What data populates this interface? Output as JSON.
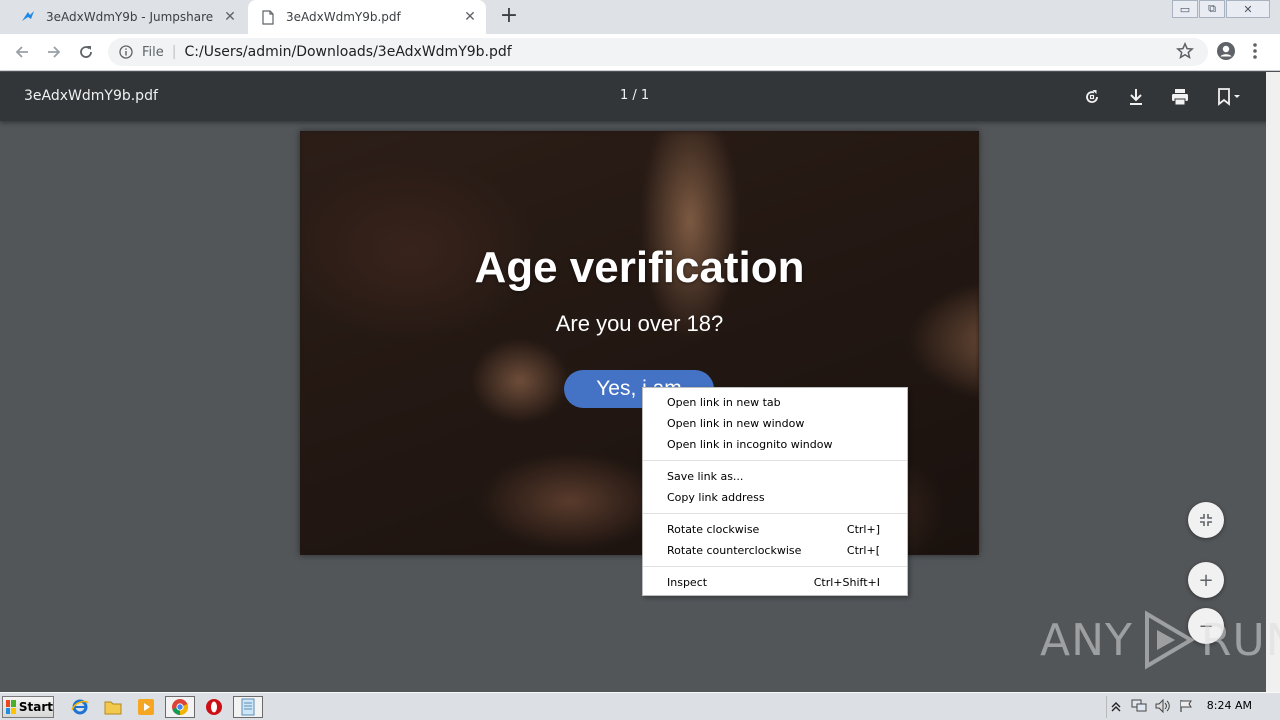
{
  "browser": {
    "tabs": [
      {
        "title": "3eAdxWdmY9b - Jumpshare",
        "favicon": "jumpshare-icon",
        "active": false
      },
      {
        "title": "3eAdxWdmY9b.pdf",
        "favicon": "document-icon",
        "active": true
      }
    ],
    "new_tab_label": "+",
    "window_controls": {
      "minimize": "▭",
      "restore": "⧉",
      "close": "✕"
    },
    "address": {
      "scheme_label": "File",
      "separator": "|",
      "url": "C:/Users/admin/Downloads/3eAdxWdmY9b.pdf"
    }
  },
  "pdf_viewer": {
    "file_name": "3eAdxWdmY9b.pdf",
    "page_indicator": "1 / 1",
    "toolbar_icons": [
      "rotate-icon",
      "download-icon",
      "print-icon",
      "bookmark-icon"
    ]
  },
  "pdf_page": {
    "title": "Age verification",
    "question": "Are you over 18?",
    "button_label": "Yes, i am"
  },
  "zoom_controls": {
    "fit": "fit-to-page-icon",
    "zoom_in": "+",
    "zoom_out": "−"
  },
  "context_menu": {
    "groups": [
      [
        {
          "label": "Open link in new tab",
          "shortcut": ""
        },
        {
          "label": "Open link in new window",
          "shortcut": ""
        },
        {
          "label": "Open link in incognito window",
          "shortcut": ""
        }
      ],
      [
        {
          "label": "Save link as...",
          "shortcut": ""
        },
        {
          "label": "Copy link address",
          "shortcut": ""
        }
      ],
      [
        {
          "label": "Rotate clockwise",
          "shortcut": "Ctrl+]"
        },
        {
          "label": "Rotate counterclockwise",
          "shortcut": "Ctrl+["
        }
      ],
      [
        {
          "label": "Inspect",
          "shortcut": "Ctrl+Shift+I"
        }
      ]
    ]
  },
  "watermark": {
    "left": "ANY",
    "right": "RUN"
  },
  "taskbar": {
    "start_label": "Start",
    "clock": "8:24 AM",
    "colors": {
      "chrome_red": "#db4437",
      "chrome_green": "#0f9d58",
      "chrome_yellow": "#f4b400",
      "chrome_blue": "#4285f4",
      "opera_red": "#cc0f16"
    }
  },
  "colors": {
    "pdf_toolbar": "#323639",
    "viewer_bg": "#525659",
    "button_blue": "#4472c4",
    "tabstrip": "#dee1e6"
  }
}
